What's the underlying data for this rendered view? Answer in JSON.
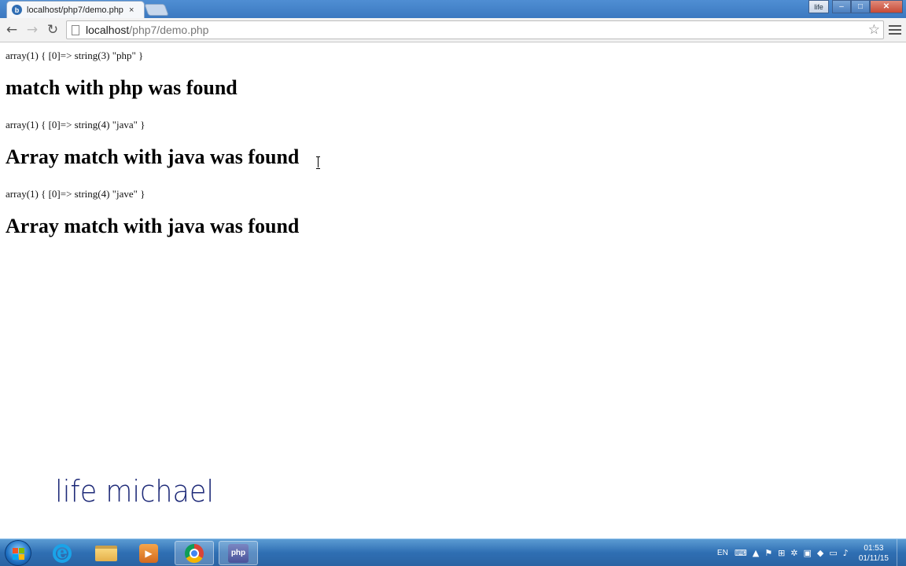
{
  "browser": {
    "tab": {
      "title": "localhost/php7/demo.php",
      "favicon": "b",
      "close": "×"
    },
    "window_controls": {
      "profile": "life",
      "minimize": "–",
      "maximize": "□",
      "close": "✕"
    },
    "nav": {
      "back": "←",
      "forward": "→",
      "reload": "↻"
    },
    "address": {
      "host": "localhost",
      "path": "/php7/demo.php"
    },
    "bookmark_star": "☆"
  },
  "page": {
    "blocks": [
      {
        "dump": "array(1) { [0]=> string(3) \"php\" }",
        "heading": "match with php was found"
      },
      {
        "dump": "array(1) { [0]=> string(4) \"java\" }",
        "heading": "Array match with java was found"
      },
      {
        "dump": "array(1) { [0]=> string(4) \"jave\" }",
        "heading": "Array match with java was found"
      }
    ],
    "watermark": "life michael"
  },
  "taskbar": {
    "language": "EN",
    "time": "01:53",
    "date": "01/11/15",
    "php_label": "php",
    "tray_icons": [
      "keyboard-icon",
      "arrow-up-icon",
      "flag-icon",
      "windows-icon",
      "network-icon",
      "shield-icon",
      "dropbox-icon",
      "battery-icon",
      "volume-icon"
    ]
  },
  "colors": {
    "taskbar": "#2f6fb3",
    "watermark": "#1e2a78",
    "tab_strip": "#4f8ed3"
  }
}
